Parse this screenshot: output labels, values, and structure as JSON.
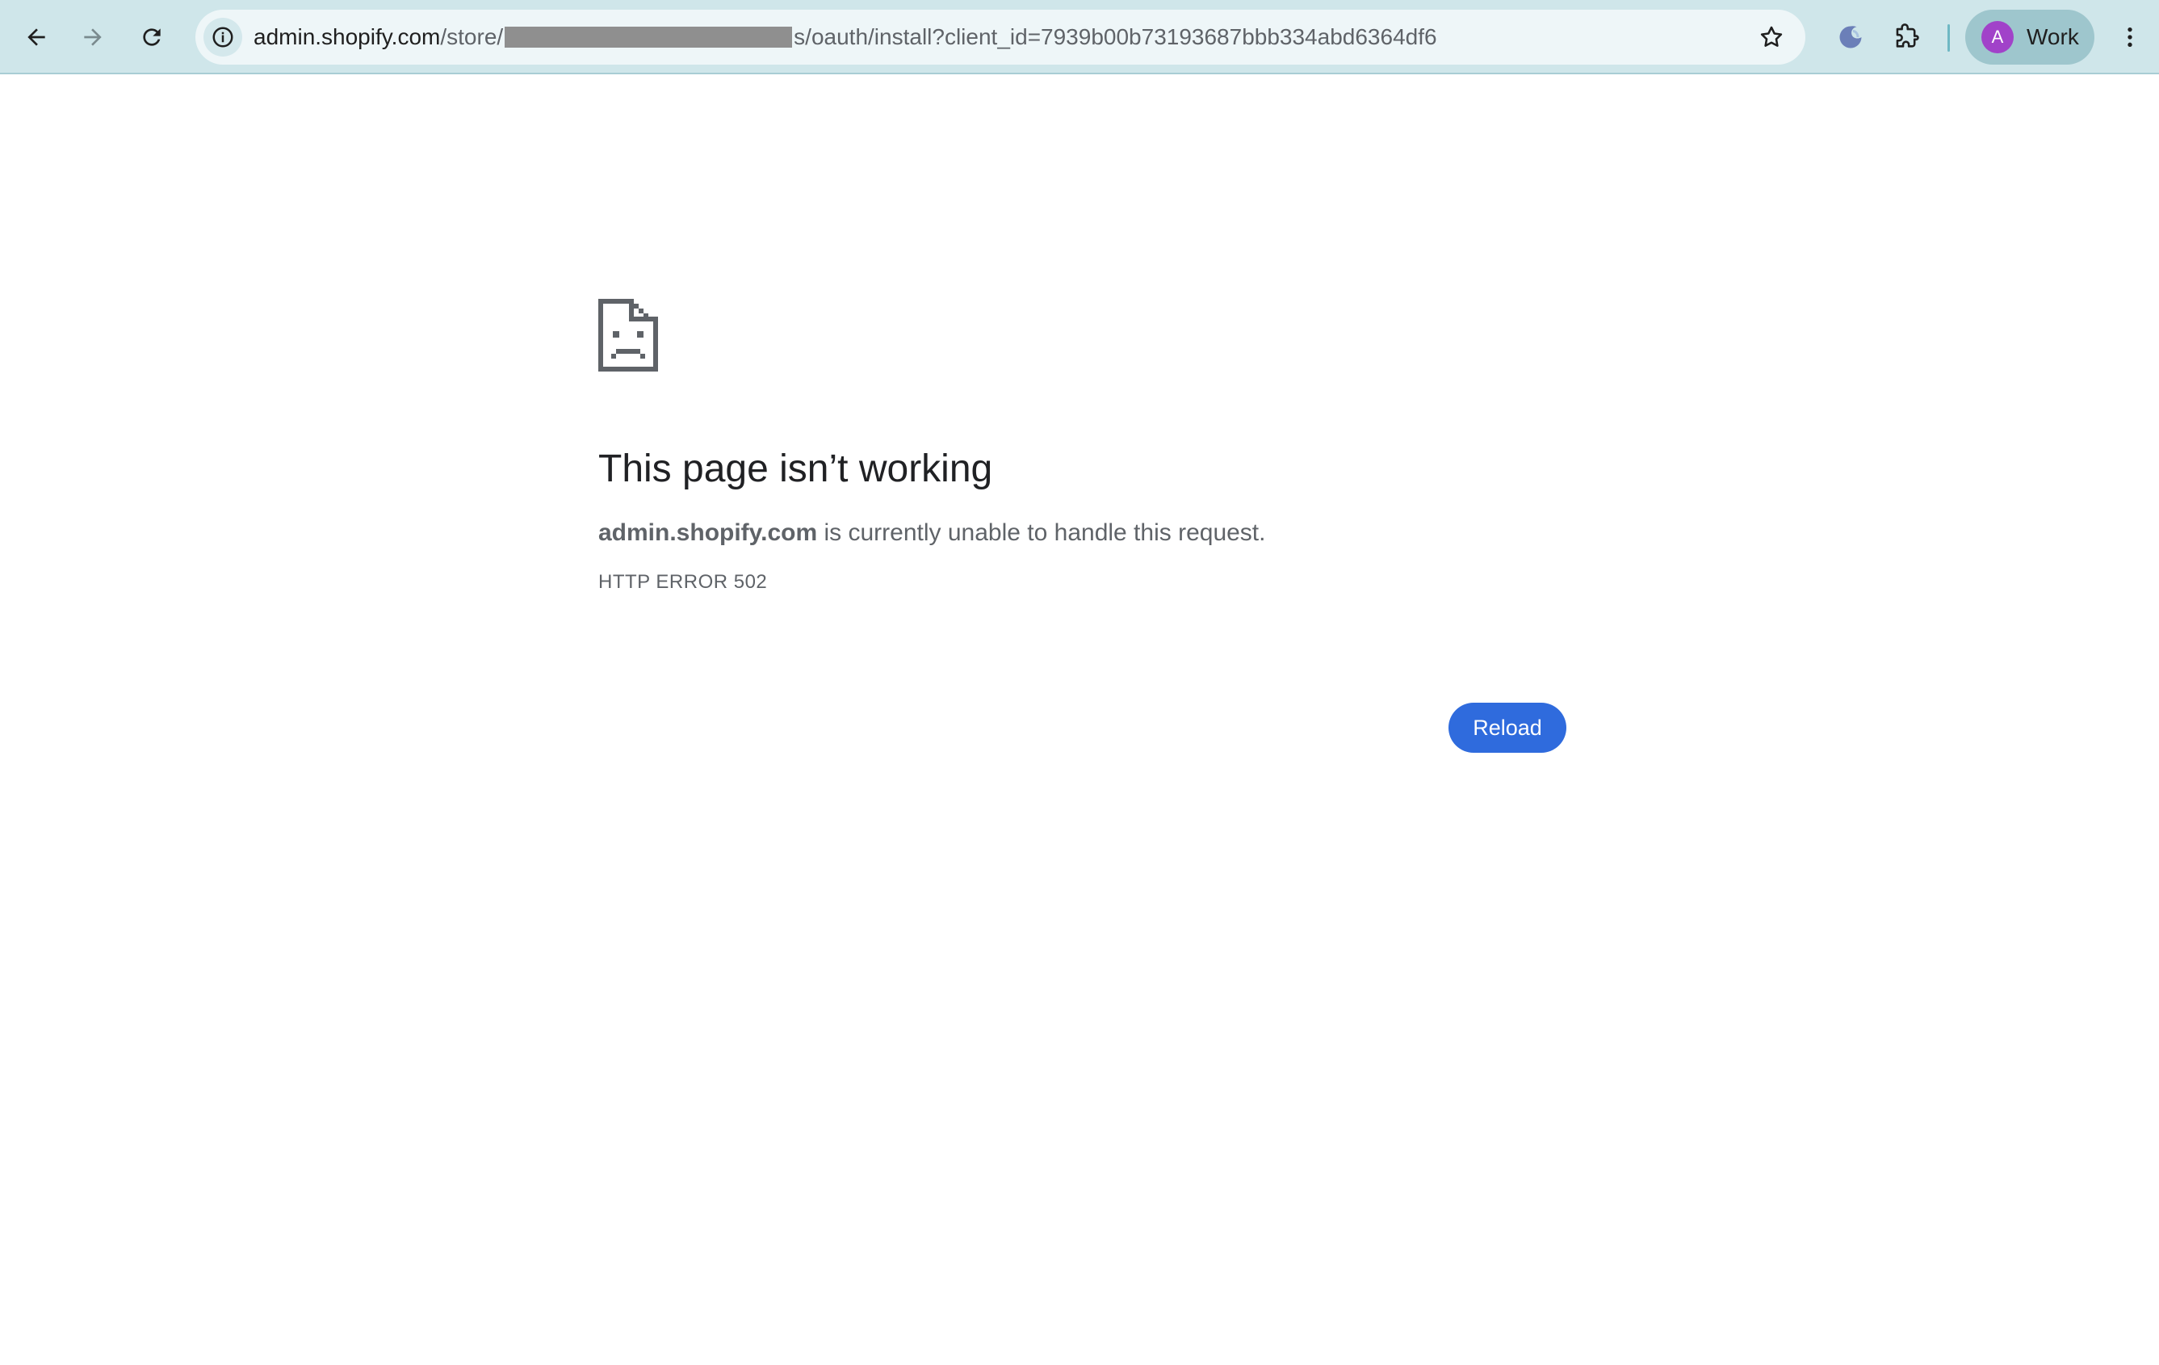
{
  "browser": {
    "nav_icons": {
      "back": "arrow-left-icon",
      "forward": "arrow-right-icon",
      "reload": "reload-icon"
    },
    "url": {
      "host": "admin.shopify.com",
      "path_before_redaction": "/store/",
      "path_after_redaction": "s/oauth/install?client_id=7939b00b73193687bbb334abd6364df6"
    },
    "profile": {
      "initial": "A",
      "name": "Work"
    },
    "colors": {
      "toolbar": "#cfe6ea",
      "avatar": "#a142c9",
      "profile_chip": "#9ec6cd"
    }
  },
  "error_page": {
    "icon": "sad-page-icon",
    "title": "This page isn’t working",
    "host": "admin.shopify.com",
    "message": " is currently unable to handle this request.",
    "error_code": "HTTP ERROR 502",
    "reload_label": "Reload",
    "accent": "#2f6bdd"
  }
}
